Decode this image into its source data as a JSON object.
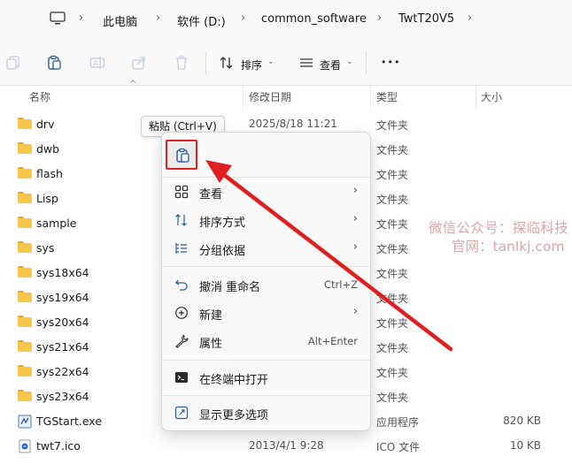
{
  "breadcrumb": {
    "items": [
      "此电脑",
      "软件 (D:)",
      "common_software",
      "TwtT20V5"
    ]
  },
  "toolbar": {
    "sort_label": "排序",
    "view_label": "查看",
    "more_label": "•••"
  },
  "columns": {
    "name": "名称",
    "date": "修改日期",
    "type": "类型",
    "size": "大小"
  },
  "files": [
    {
      "name": "drv",
      "date": "2025/8/18 11:21",
      "type": "文件夹",
      "size": "",
      "icon": "folder-icon"
    },
    {
      "name": "dwb",
      "date": "",
      "type": "文件夹",
      "size": "",
      "icon": "folder-icon"
    },
    {
      "name": "flash",
      "date": "",
      "type": "文件夹",
      "size": "",
      "icon": "folder-icon"
    },
    {
      "name": "Lisp",
      "date": "",
      "type": "文件夹",
      "size": "",
      "icon": "folder-icon"
    },
    {
      "name": "sample",
      "date": "",
      "type": "文件夹",
      "size": "",
      "icon": "folder-icon"
    },
    {
      "name": "sys",
      "date": "",
      "type": "文件夹",
      "size": "",
      "icon": "folder-icon"
    },
    {
      "name": "sys18x64",
      "date": "",
      "type": "文件夹",
      "size": "",
      "icon": "folder-icon"
    },
    {
      "name": "sys19x64",
      "date": "",
      "type": "文件夹",
      "size": "",
      "icon": "folder-icon"
    },
    {
      "name": "sys20x64",
      "date": "",
      "type": "文件夹",
      "size": "",
      "icon": "folder-icon"
    },
    {
      "name": "sys21x64",
      "date": "",
      "type": "文件夹",
      "size": "",
      "icon": "folder-icon"
    },
    {
      "name": "sys22x64",
      "date": "",
      "type": "文件夹",
      "size": "",
      "icon": "folder-icon"
    },
    {
      "name": "sys23x64",
      "date": "",
      "type": "文件夹",
      "size": "",
      "icon": "folder-icon"
    },
    {
      "name": "TGStart.exe",
      "date": "",
      "type": "应用程序",
      "size": "820 KB",
      "icon": "exe-icon"
    },
    {
      "name": "twt7.ico",
      "date": "2013/4/1 9:28",
      "type": "ICO 文件",
      "size": "10 KB",
      "icon": "ico-file-icon"
    }
  ],
  "tooltip": {
    "text": "粘贴 (Ctrl+V)"
  },
  "context_menu": {
    "view": "查看",
    "sort_by": "排序方式",
    "group_by": "分组依据",
    "undo_rename": "撤消 重命名",
    "undo_shortcut": "Ctrl+Z",
    "new": "新建",
    "properties": "属性",
    "properties_shortcut": "Alt+Enter",
    "open_terminal": "在终端中打开",
    "show_more": "显示更多选项"
  },
  "watermark": {
    "line1": "微信公众号：探临科技",
    "line2": "官网：tanlkj.com"
  },
  "colors": {
    "accent": "#0067c0",
    "annotation_red": "#e02020",
    "folder": "#f8c64a"
  }
}
